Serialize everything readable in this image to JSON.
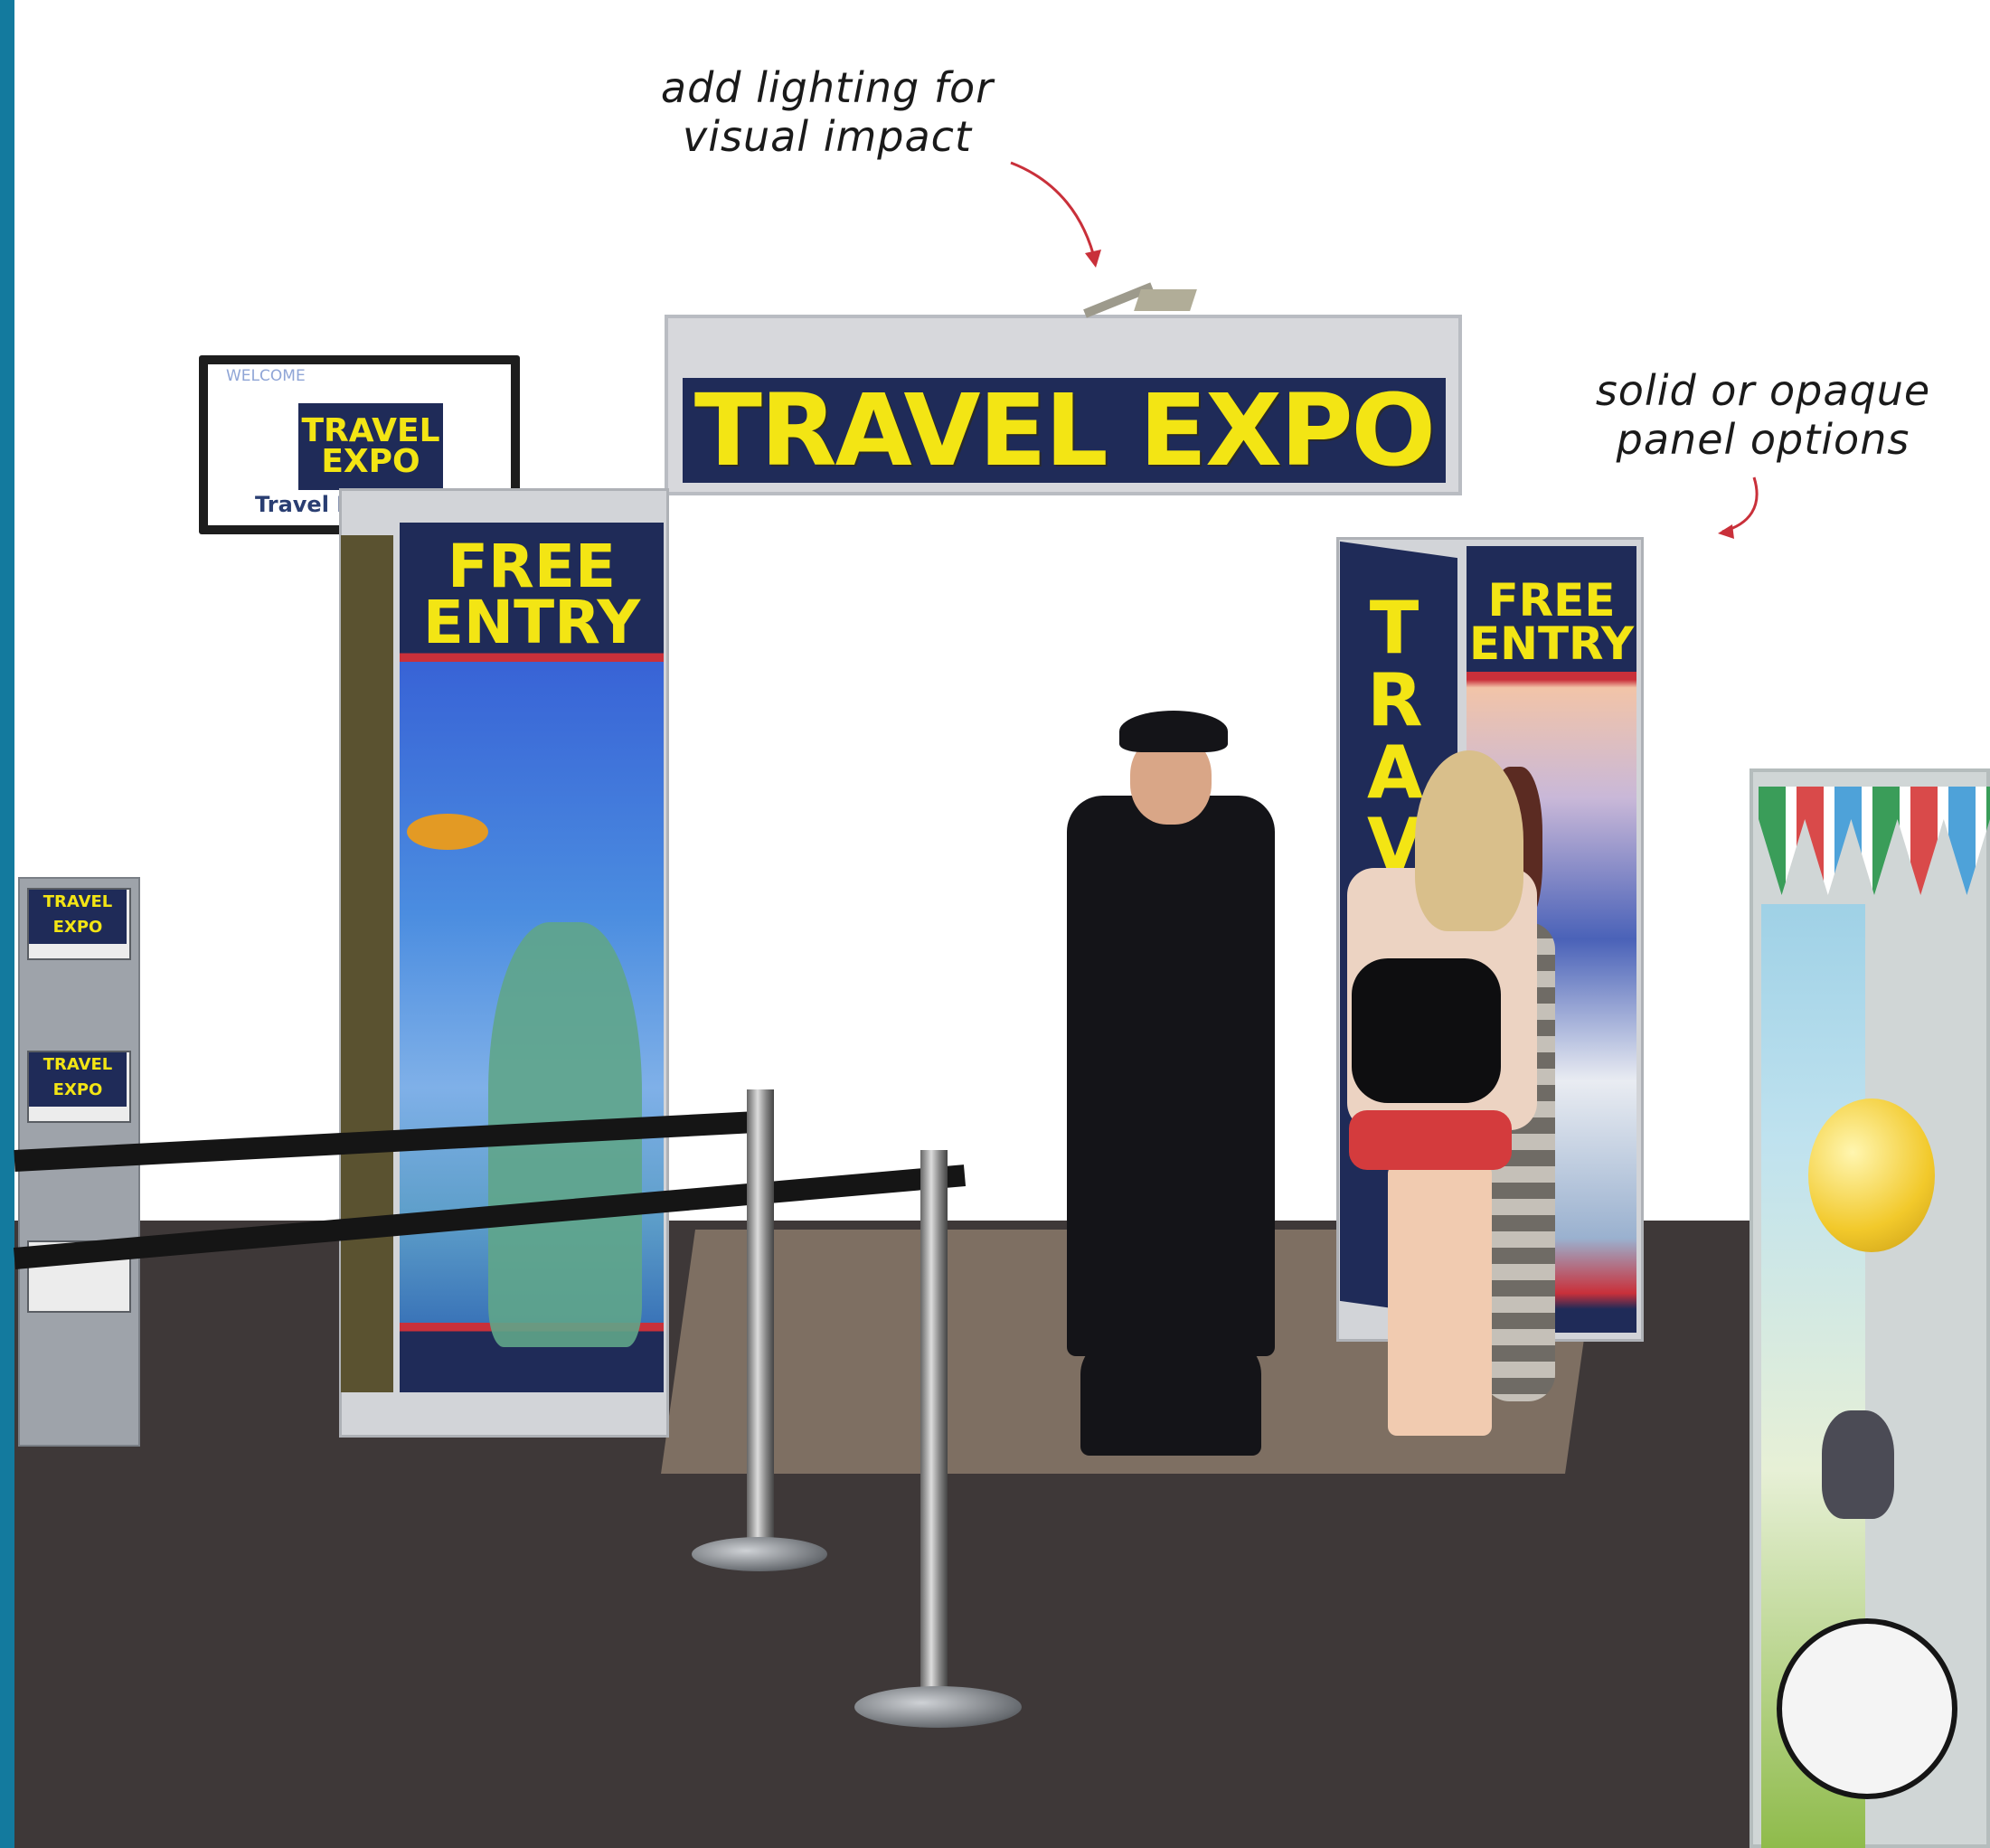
{
  "annotations": {
    "lighting_note": "add lighting for visual impact",
    "panel_note": "solid or opaque panel options"
  },
  "signage": {
    "main_banner": "TRAVEL EXPO",
    "left_pillar": "FREE ENTRY",
    "right_pillar": "FREE ENTRY",
    "right_pillar_side": "TRAVE",
    "left_pillar_side": "FREE ENTRY"
  },
  "screen": {
    "welcome": "WELCOME",
    "logo": "TRAVEL EXPO",
    "caption": "Travel Ex"
  },
  "brochures": {
    "label": "TRAVEL EXPO"
  },
  "colors": {
    "banner_bg": "#1f2b58",
    "banner_text": "#f3e514",
    "accent_red": "#c9303a",
    "annotation_arrow": "#c9303a",
    "left_strip": "#137a9e"
  }
}
